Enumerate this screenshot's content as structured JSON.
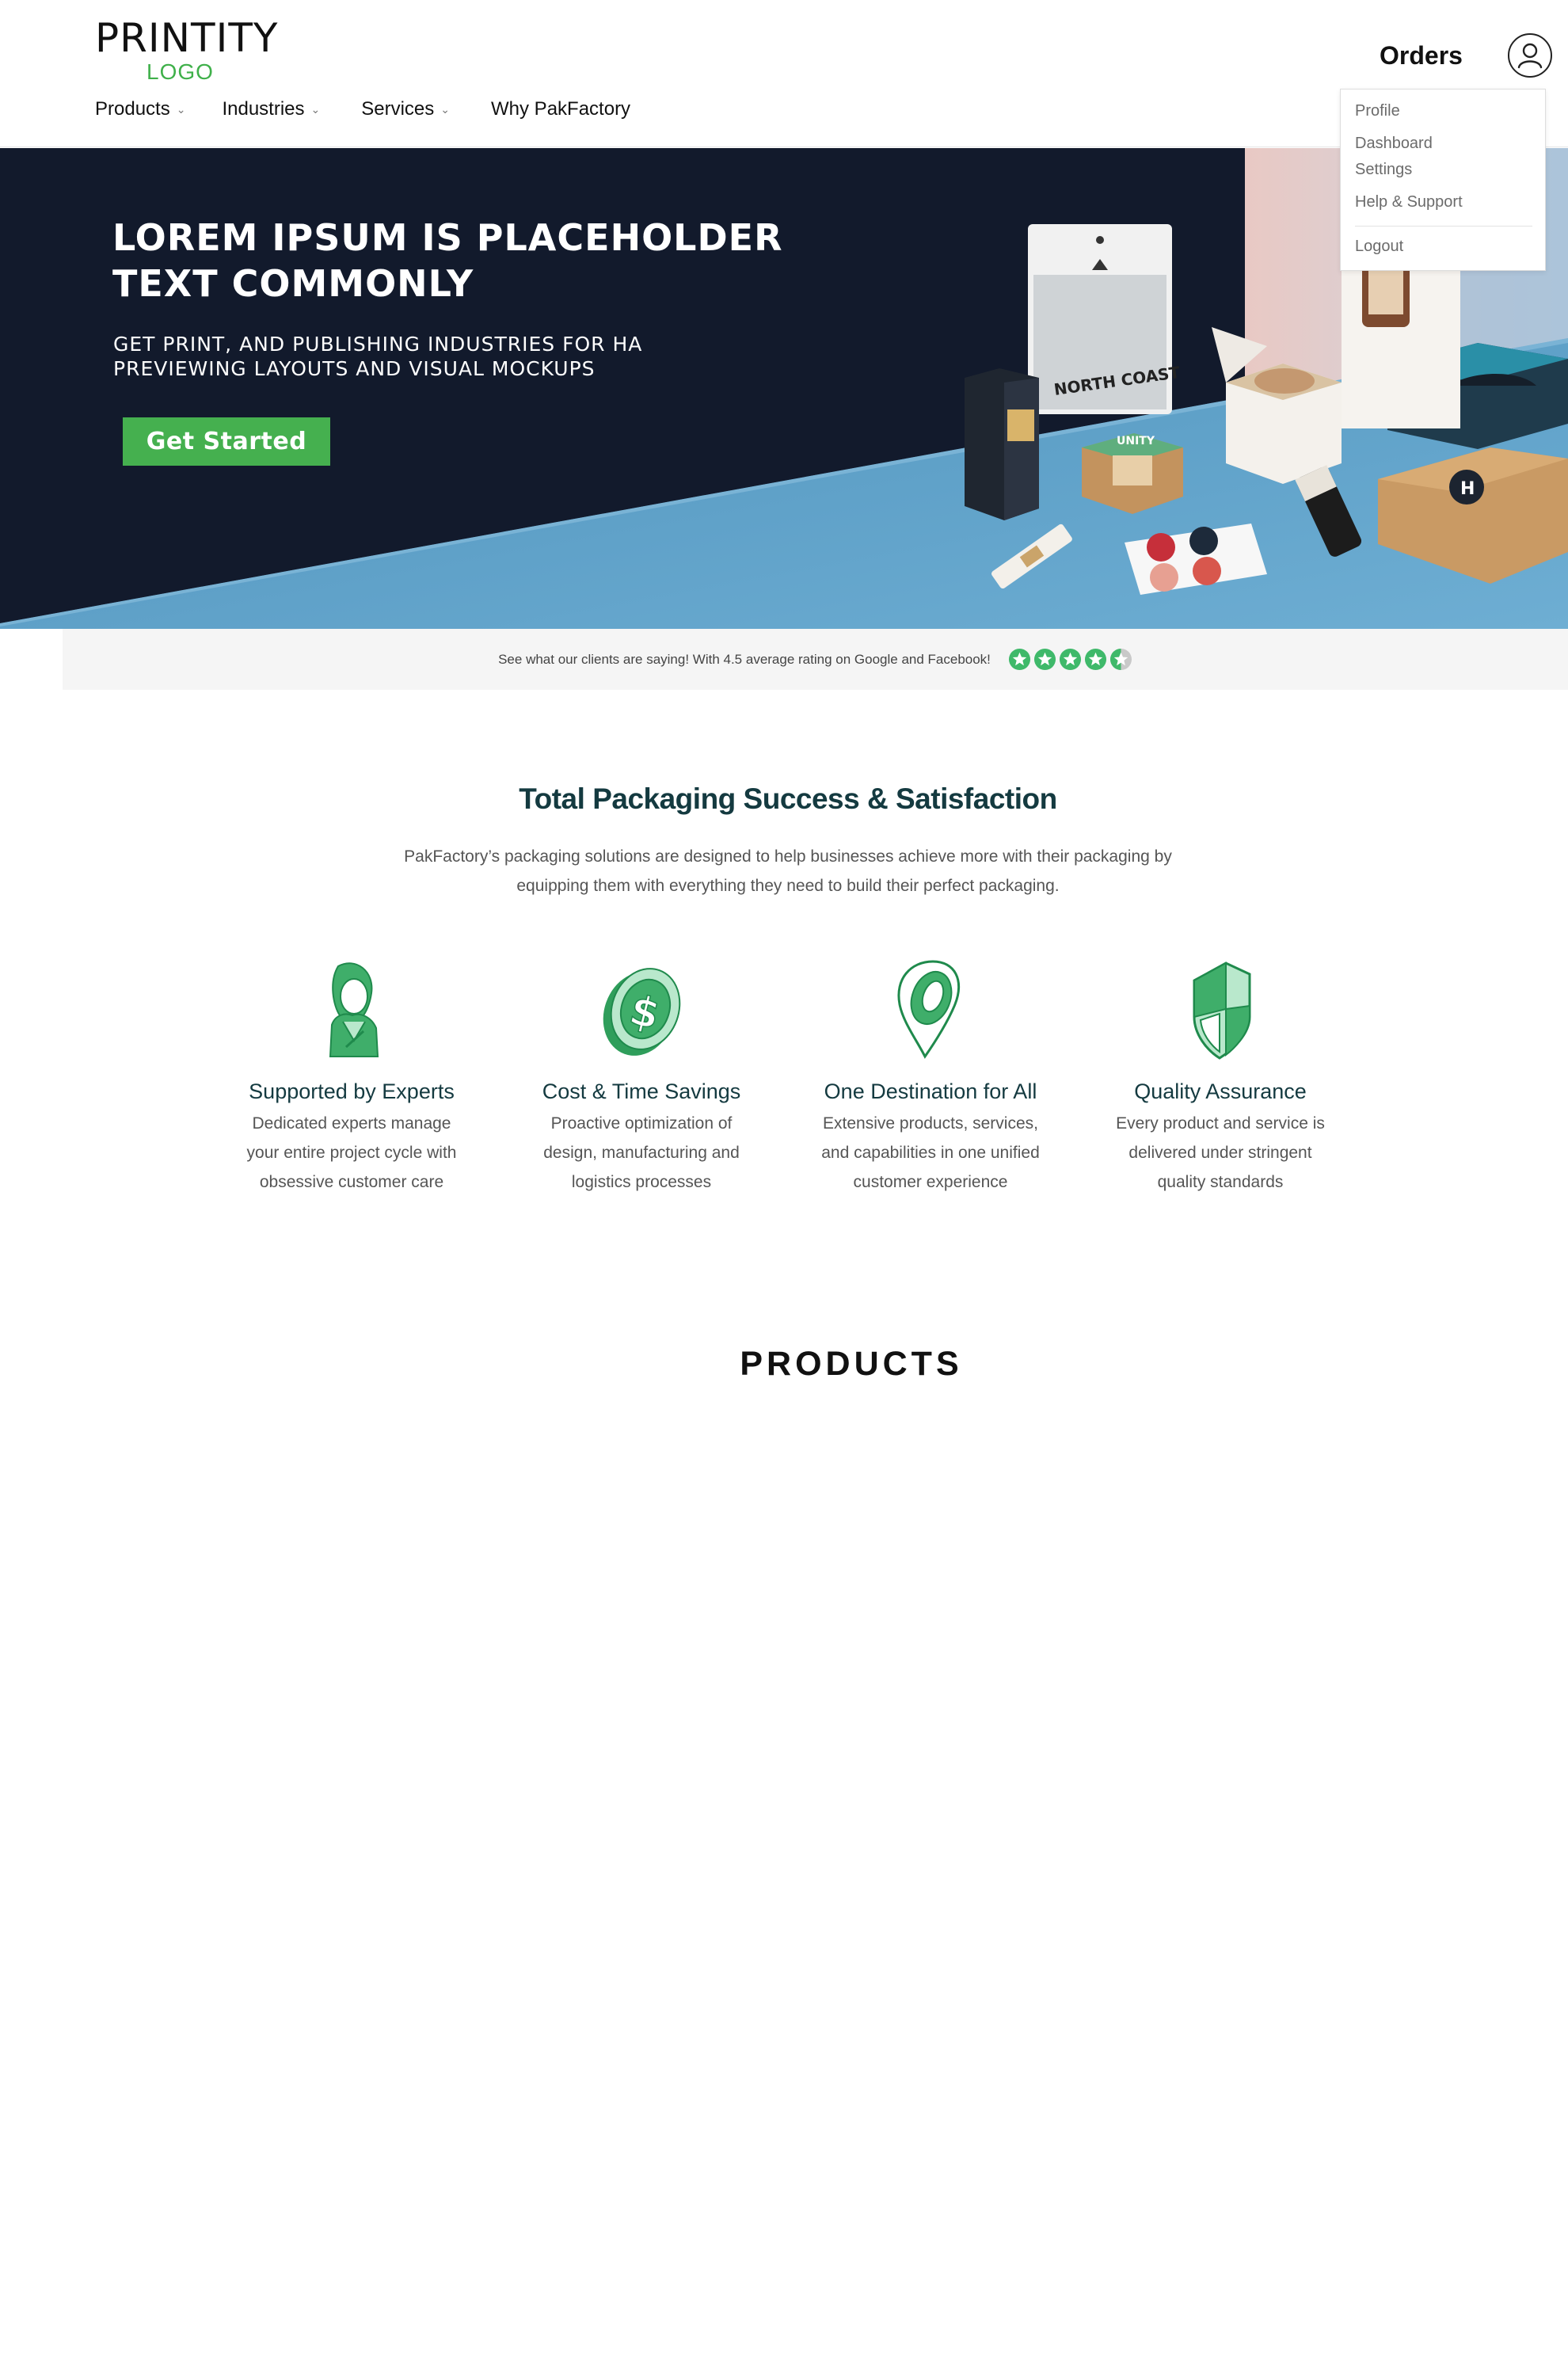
{
  "header": {
    "logo_main": "PRINTITY",
    "logo_sub": "LOGO",
    "nav": [
      {
        "label": "Products",
        "has_dropdown": true
      },
      {
        "label": "Industries",
        "has_dropdown": true
      },
      {
        "label": "Services",
        "has_dropdown": true
      },
      {
        "label": "Why PakFactory",
        "has_dropdown": false
      }
    ],
    "orders_label": "Orders",
    "avatar_icon": "user-icon"
  },
  "user_menu": {
    "items": [
      "Profile",
      "Dashboard",
      "Settings",
      "Help & Support",
      "Logout"
    ]
  },
  "hero": {
    "title": "LOREM IPSUM IS PLACEHOLDER TEXT COMMONLY",
    "subtitle": "GET PRINT, AND PUBLISHING INDUSTRIES FOR  HA PREVIEWING LAYOUTS AND VISUAL MOCKUPS",
    "cta_label": "Get Started",
    "product_labels": [
      "NORTH COAST",
      "UNITY"
    ]
  },
  "rating": {
    "text": "See what our clients are saying! With 4.5 average rating on Google and Facebook!",
    "value": 4.5,
    "max": 5
  },
  "success": {
    "title": "Total Packaging Success & Satisfaction",
    "description": "PakFactory’s packaging solutions are designed to help businesses achieve more with their packaging by equipping them with everything they need to build their perfect packaging.",
    "features": [
      {
        "icon": "expert-person-icon",
        "title": "Supported by Experts",
        "description": "Dedicated experts manage your entire project cycle with obsessive customer care"
      },
      {
        "icon": "dollar-coin-icon",
        "title": "Cost & Time Savings",
        "description": "Proactive optimization of design, manufacturing and logistics processes"
      },
      {
        "icon": "location-pin-icon",
        "title": "One Destination for All",
        "description": "Extensive products, services, and capabilities in one unified customer experience"
      },
      {
        "icon": "shield-icon",
        "title": "Quality Assurance",
        "description": "Every product and service is delivered under stringent quality standards"
      }
    ]
  },
  "products": {
    "heading": "PRODUCTS"
  },
  "colors": {
    "brand_green": "#45b04f",
    "hero_dark": "#121a2c",
    "hero_blue": "#5a9cc4",
    "heading_teal": "#143a40"
  }
}
